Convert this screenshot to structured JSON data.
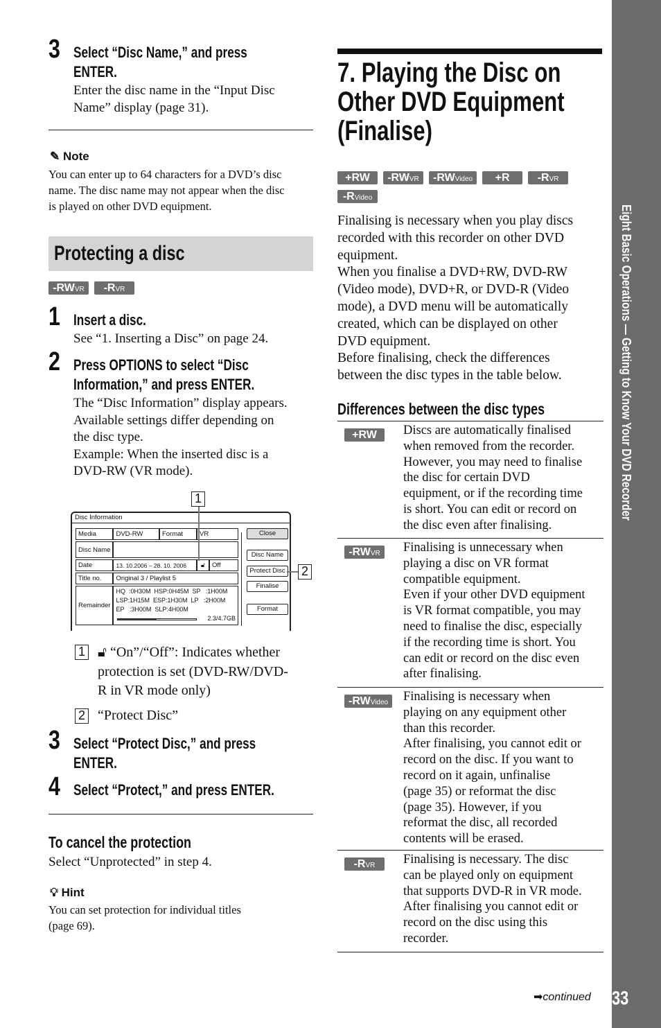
{
  "left": {
    "step3a": {
      "num": "3",
      "title1": "Select “Disc Name,” and press",
      "title2": "ENTER.",
      "body": [
        "Enter the disc name in the “Input Disc",
        "Name” display (page 31)."
      ]
    },
    "note": {
      "label": "Note",
      "icon": "note-icon",
      "lines": [
        "You can enter up to 64 characters for a DVD’s disc",
        "name. The disc name may not appear when the disc",
        "is played on other DVD equipment."
      ]
    },
    "section_title": "Protecting a disc",
    "badges": [
      "-RWVR",
      "-RVR"
    ],
    "step1": {
      "num": "1",
      "title": "Insert a disc.",
      "body": "See “1. Inserting a Disc” on page 24."
    },
    "step2": {
      "num": "2",
      "title1": "Press OPTIONS to select “Disc",
      "title2": "Information,” and press ENTER.",
      "body": [
        "The “Disc Information” display appears.",
        "Available settings differ depending on",
        "the disc type.",
        "Example: When the inserted disc is a",
        "DVD-RW (VR mode)."
      ]
    },
    "osd": {
      "title": "Disc Information",
      "media_label": "Media",
      "media": "DVD-RW",
      "format_label": "Format",
      "format": "VR",
      "disc_name_label": "Disc Name",
      "date_label": "Date",
      "date": "13. 10.2006 – 28. 10. 2006",
      "protect": "Off",
      "title_label": "Title no.",
      "title_value": "Original   3 / Playlist  5",
      "remainder_label": "Remainder",
      "remainder": [
        "HQ  :0H30M  HSP:0H45M  SP   :1H00M",
        "LSP:1H15M  ESP:1H30M  LP   :2H00M",
        "EP   :3H00M  SLP:4H00M"
      ],
      "capacity": "2.3/4.7GB",
      "usage_fraction": 0.49,
      "buttons": [
        "Close",
        "Disc Name",
        "Protect Disc",
        "Finalise",
        "Format"
      ],
      "callout1": "1",
      "callout2": "2"
    },
    "callouts": [
      {
        "num": "1",
        "lines": [
          "“On”/“Off”: Indicates whether",
          "protection is set (DVD-RW/DVD-",
          "R in VR mode only)"
        ]
      },
      {
        "num": "2",
        "lines": [
          "“Protect Disc”"
        ]
      }
    ],
    "step3": {
      "num": "3",
      "title1": "Select “Protect Disc,” and press",
      "title2": "ENTER."
    },
    "step4": {
      "num": "4",
      "title": "Select “Protect,” and press ENTER."
    },
    "cancel": {
      "title": "To cancel the protection",
      "body": "Select “Unprotected” in step 4."
    },
    "hint": {
      "label": "Hint",
      "icon": "hint-bulb-icon",
      "lines": [
        "You can set protection for individual titles",
        "(page 69)."
      ]
    }
  },
  "right": {
    "title": [
      "7. Playing the Disc on",
      "Other DVD Equipment",
      "(Finalise)"
    ],
    "badges": [
      "+RW",
      "-RWVR",
      "-RWVideo",
      "+R",
      "-RVR",
      "-RVideo"
    ],
    "intro": [
      "Finalising is necessary when you play discs",
      "recorded with this recorder on other DVD",
      "equipment.",
      "When you finalise a DVD+RW, DVD-RW",
      "(Video mode), DVD+R, or DVD-R (Video",
      "mode), a DVD menu will be automatically",
      "created, which can be displayed on other",
      "DVD equipment.",
      "Before finalising, check the differences",
      "between the disc types in the table below."
    ],
    "table_title": "Differences between the disc types",
    "rows": [
      {
        "badge": "+RW",
        "lines": [
          "Discs are automatically finalised",
          "when removed from the recorder.",
          "However, you may need to finalise",
          "the disc for certain DVD",
          "equipment, or if the recording time",
          "is short. You can edit or record on",
          "the disc even after finalising."
        ]
      },
      {
        "badge": "-RWVR",
        "lines": [
          "Finalising is unnecessary when",
          "playing a disc on VR format",
          "compatible equipment.",
          "Even if your other DVD equipment",
          "is VR format compatible, you may",
          "need to finalise the disc, especially",
          "if the recording time is short. You",
          "can edit or record on the disc even",
          "after finalising."
        ]
      },
      {
        "badge": "-RWVideo",
        "lines": [
          "Finalising is necessary when",
          "playing on any equipment other",
          "than this recorder.",
          "After finalising, you cannot edit or",
          "record on the disc. If you want to",
          "record on it again, unfinalise",
          "(page 35) or reformat the disc",
          "(page 35). However, if you",
          "reformat the disc, all recorded",
          "contents will be erased."
        ]
      },
      {
        "badge": "-RVR",
        "lines": [
          "Finalising is necessary. The disc",
          "can be played only on equipment",
          "that supports DVD-R in VR mode.",
          "After finalising you cannot edit or",
          "record on the disc using this",
          "recorder."
        ]
      }
    ]
  },
  "sidebar": {
    "label": "Eight Basic Operations — Getting to Know Your DVD Recorder",
    "color": "#6b6b6b"
  },
  "footer": {
    "continued": "continued",
    "page": "33"
  }
}
